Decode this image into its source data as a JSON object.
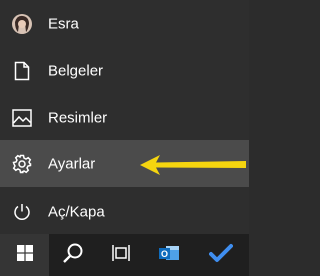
{
  "start_menu": {
    "items": [
      {
        "label": "Esra",
        "icon": "user-avatar-icon"
      },
      {
        "label": "Belgeler",
        "icon": "document-icon"
      },
      {
        "label": "Resimler",
        "icon": "image-icon"
      },
      {
        "label": "Ayarlar",
        "icon": "gear-icon"
      },
      {
        "label": "Aç/Kapa",
        "icon": "power-icon"
      }
    ],
    "highlighted": "Ayarlar"
  },
  "annotation": {
    "color": "#f5d50f",
    "icon": "arrow-left-icon"
  },
  "taskbar": {
    "buttons": [
      {
        "icon": "windows-logo-icon"
      },
      {
        "icon": "search-icon"
      },
      {
        "icon": "task-view-icon"
      },
      {
        "icon": "outlook-icon"
      },
      {
        "icon": "todo-checkmark-icon"
      }
    ]
  },
  "colors": {
    "menu_bg": "#2e2e2e",
    "active_bg": "#4b4b4b",
    "taskbar_bg": "#1f1f1f",
    "outlook_blue": "#0f6cbd",
    "todo_blue": "#3f8ef0"
  }
}
